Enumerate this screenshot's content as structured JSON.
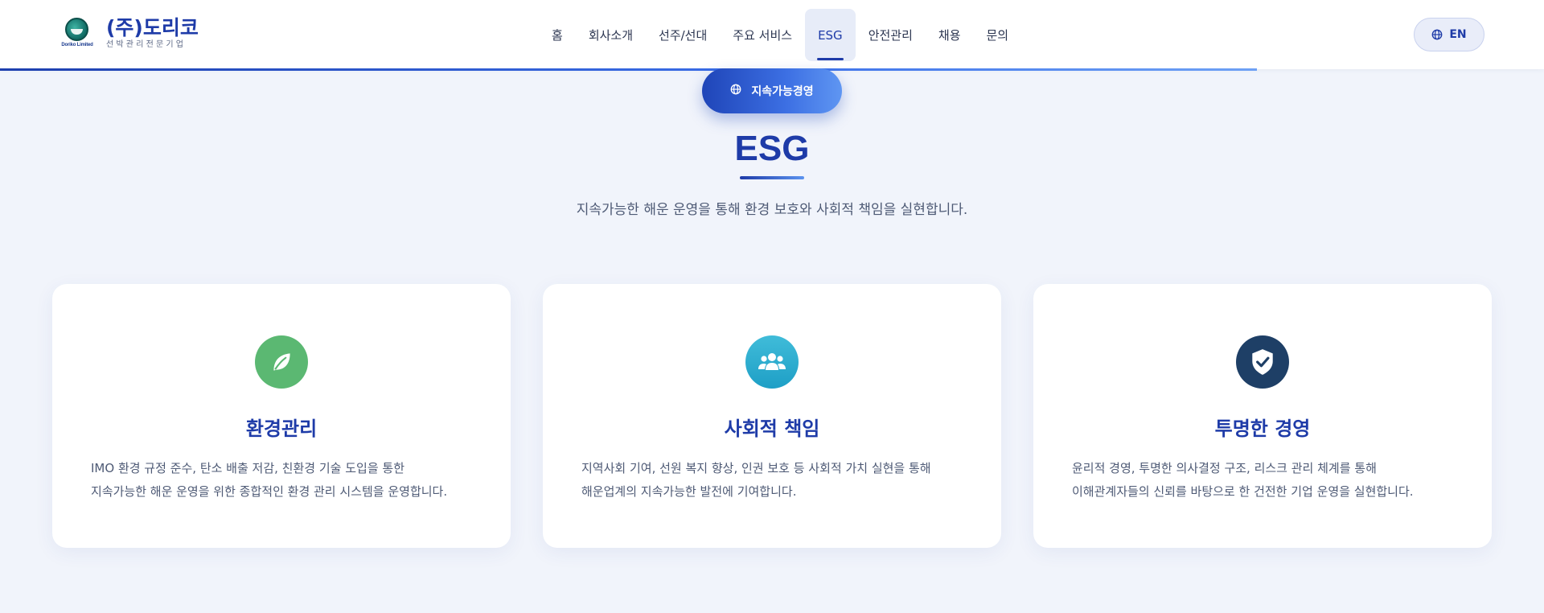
{
  "header": {
    "logo_title": "(주)도리코",
    "logo_subtitle": "선박관리전문기업",
    "logo_mark_text": "Doriko Limited",
    "nav": [
      {
        "label": "홈"
      },
      {
        "label": "회사소개"
      },
      {
        "label": "선주/선대"
      },
      {
        "label": "주요 서비스"
      },
      {
        "label": "ESG",
        "active": true
      },
      {
        "label": "안전관리"
      },
      {
        "label": "채용"
      },
      {
        "label": "문의"
      }
    ],
    "lang_label": "EN",
    "lang_icon": "globe-icon"
  },
  "hero": {
    "badge_label": "지속가능경영",
    "badge_icon": "globe-icon",
    "title": "ESG",
    "subtitle": "지속가능한 해운 운영을 통해 환경 보호와 사회적 책임을 실현합니다."
  },
  "cards": [
    {
      "icon": "leaf-icon",
      "icon_color": "#5bb872",
      "title": "환경관리",
      "lines": [
        "IMO 환경 규정 준수, 탄소 배출 저감, 친환경 기술 도입을 통한",
        "지속가능한 해운 운영을 위한 종합적인 환경 관리 시스템을 운영합니다."
      ]
    },
    {
      "icon": "users-icon",
      "icon_color": "#2cadd0",
      "title": "사회적 책임",
      "lines": [
        "지역사회 기여, 선원 복지 향상, 인권 보호 등 사회적 가치 실현을 통해",
        "해운업계의 지속가능한 발전에 기여합니다."
      ]
    },
    {
      "icon": "shield-check-icon",
      "icon_color": "#1e3f66",
      "title": "투명한 경영",
      "lines": [
        "윤리적 경영, 투명한 의사결정 구조, 리스크 관리 체계를 통해",
        "이해관계자들의 신뢰를 바탕으로 한 건전한 기업 운영을 실현합니다."
      ]
    }
  ],
  "colors": {
    "primary": "#1e3ba8",
    "background": "#f1f4fb"
  }
}
